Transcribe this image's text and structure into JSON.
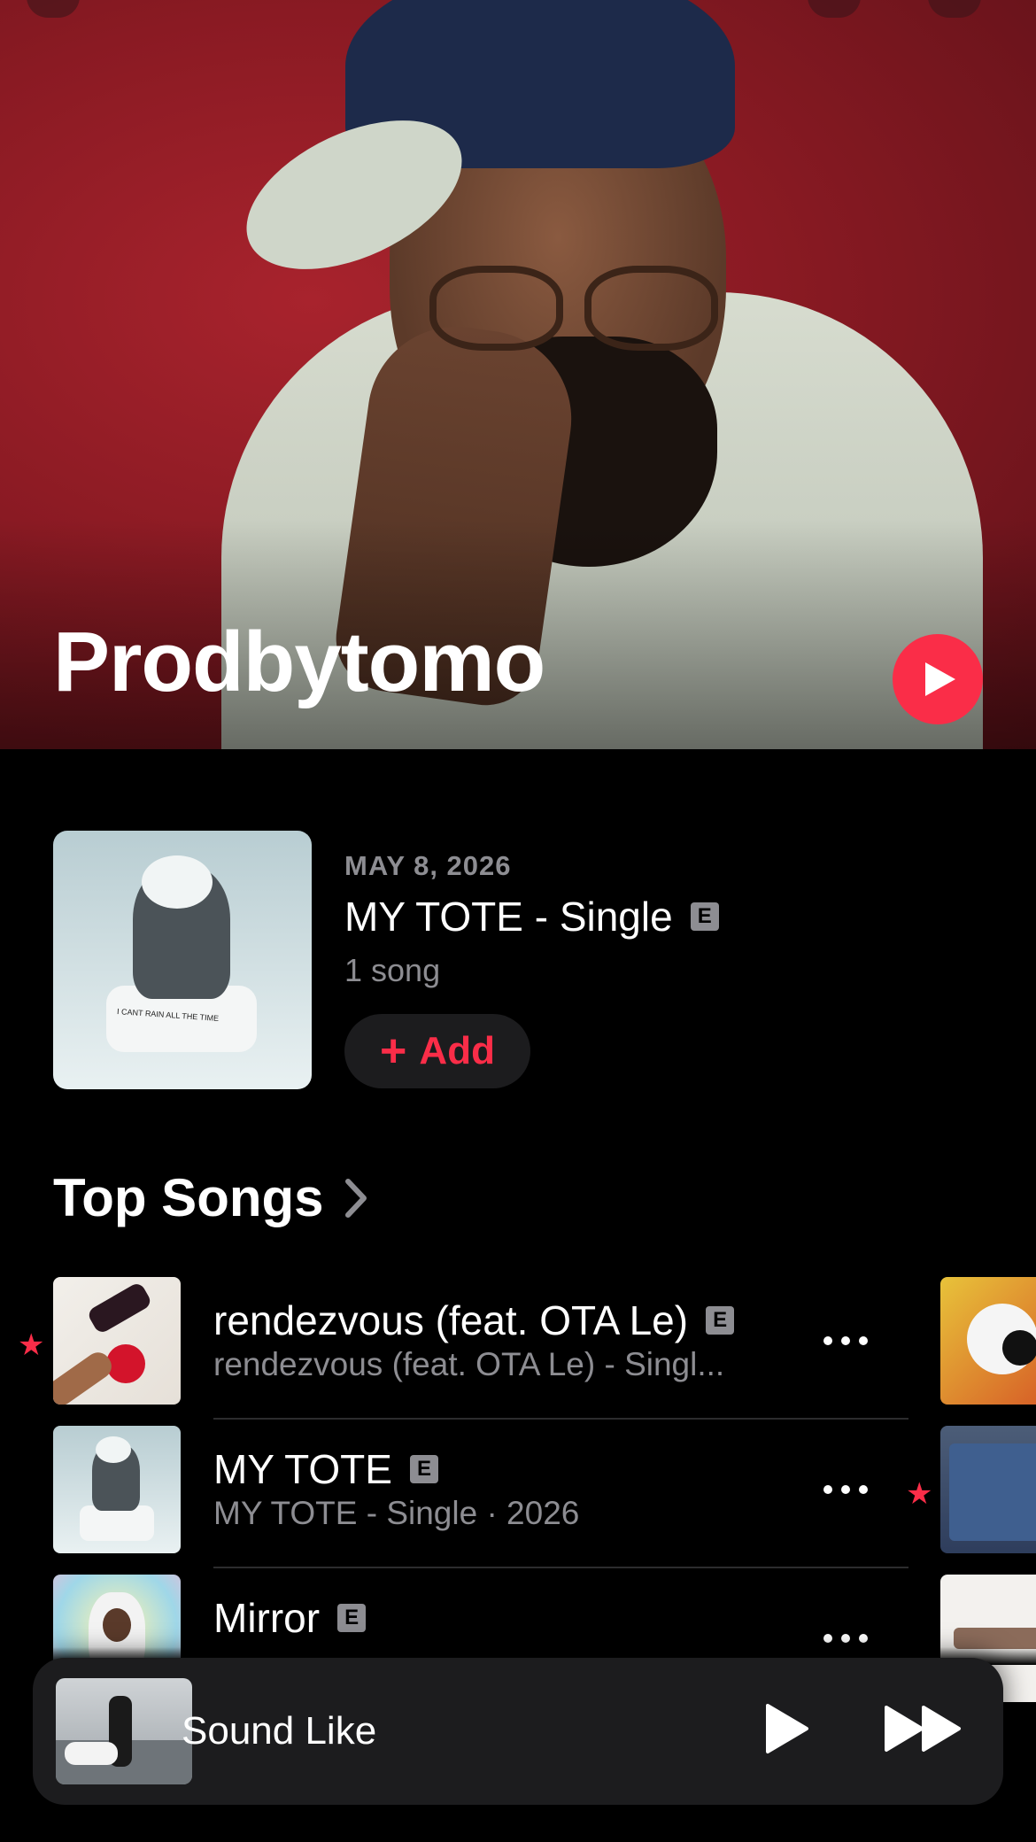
{
  "artist": {
    "name": "Prodbytomo"
  },
  "latest_release": {
    "date": "MAY 8, 2026",
    "title": "MY TOTE - Single",
    "explicit_badge": "E",
    "count": "1 song",
    "add_label": "Add",
    "add_icon": "plus-icon",
    "art_text": "I CANT RAIN ALL THE TIME"
  },
  "top_songs": {
    "title": "Top Songs",
    "items": [
      {
        "title": "rendezvous (feat. OTA Le)",
        "explicit": "E",
        "subtitle": "rendezvous (feat. OTA Le) - Singl...",
        "starred": true
      },
      {
        "title": "MY TOTE",
        "explicit": "E",
        "subtitle": "MY TOTE - Single · 2026",
        "starred": false
      },
      {
        "title": "Mirror",
        "explicit": "E",
        "subtitle": "",
        "starred": false
      }
    ]
  },
  "now_playing": {
    "title": "Sound Like",
    "play_icon": "play-icon",
    "next_icon": "fast-forward-icon"
  },
  "colors": {
    "accent": "#fa2d48",
    "background": "#000000",
    "secondary_text": "#8d8d92",
    "card": "#1c1c1e"
  }
}
